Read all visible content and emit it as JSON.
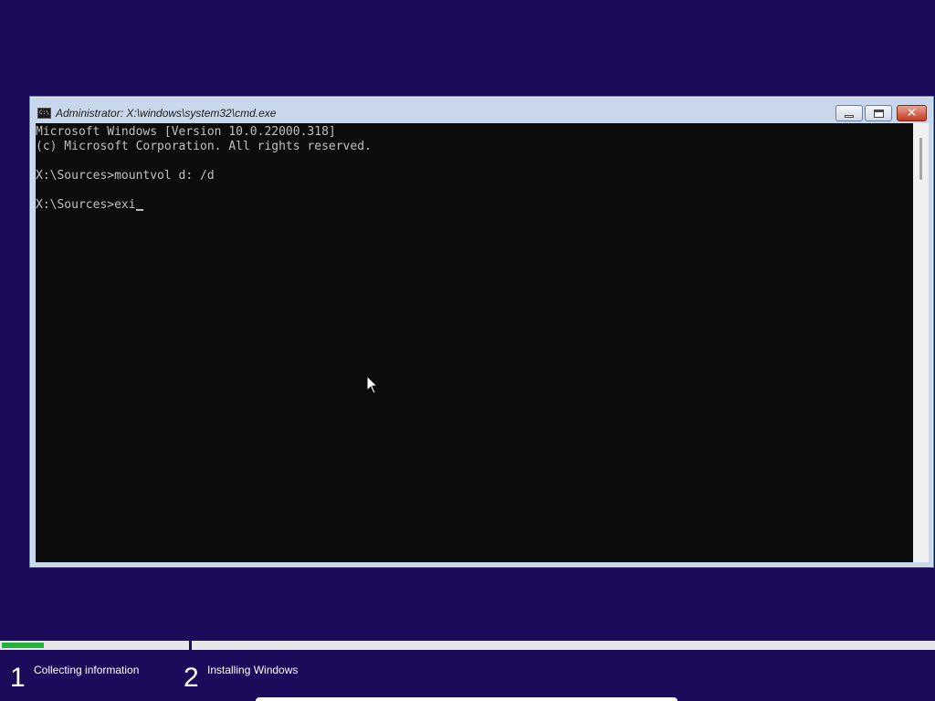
{
  "window": {
    "title": "Administrator: X:\\windows\\system32\\cmd.exe",
    "icon_label": "C:\\",
    "minimize_glyph": "",
    "close_glyph": "✕"
  },
  "console": {
    "lines": [
      "Microsoft Windows [Version 10.0.22000.318]",
      "(c) Microsoft Corporation. All rights reserved.",
      "",
      "X:\\Sources>mountvol d: /d",
      "",
      "X:\\Sources>exi"
    ]
  },
  "setup": {
    "progress": 0.045,
    "progress_color": "#22b33a",
    "steps": [
      {
        "number": "1",
        "label": "Collecting information"
      },
      {
        "number": "2",
        "label": "Installing Windows"
      }
    ]
  },
  "colors": {
    "background": "#1c0a5a",
    "console_bg": "#0c0c0c",
    "console_fg": "#c0c0c0"
  }
}
